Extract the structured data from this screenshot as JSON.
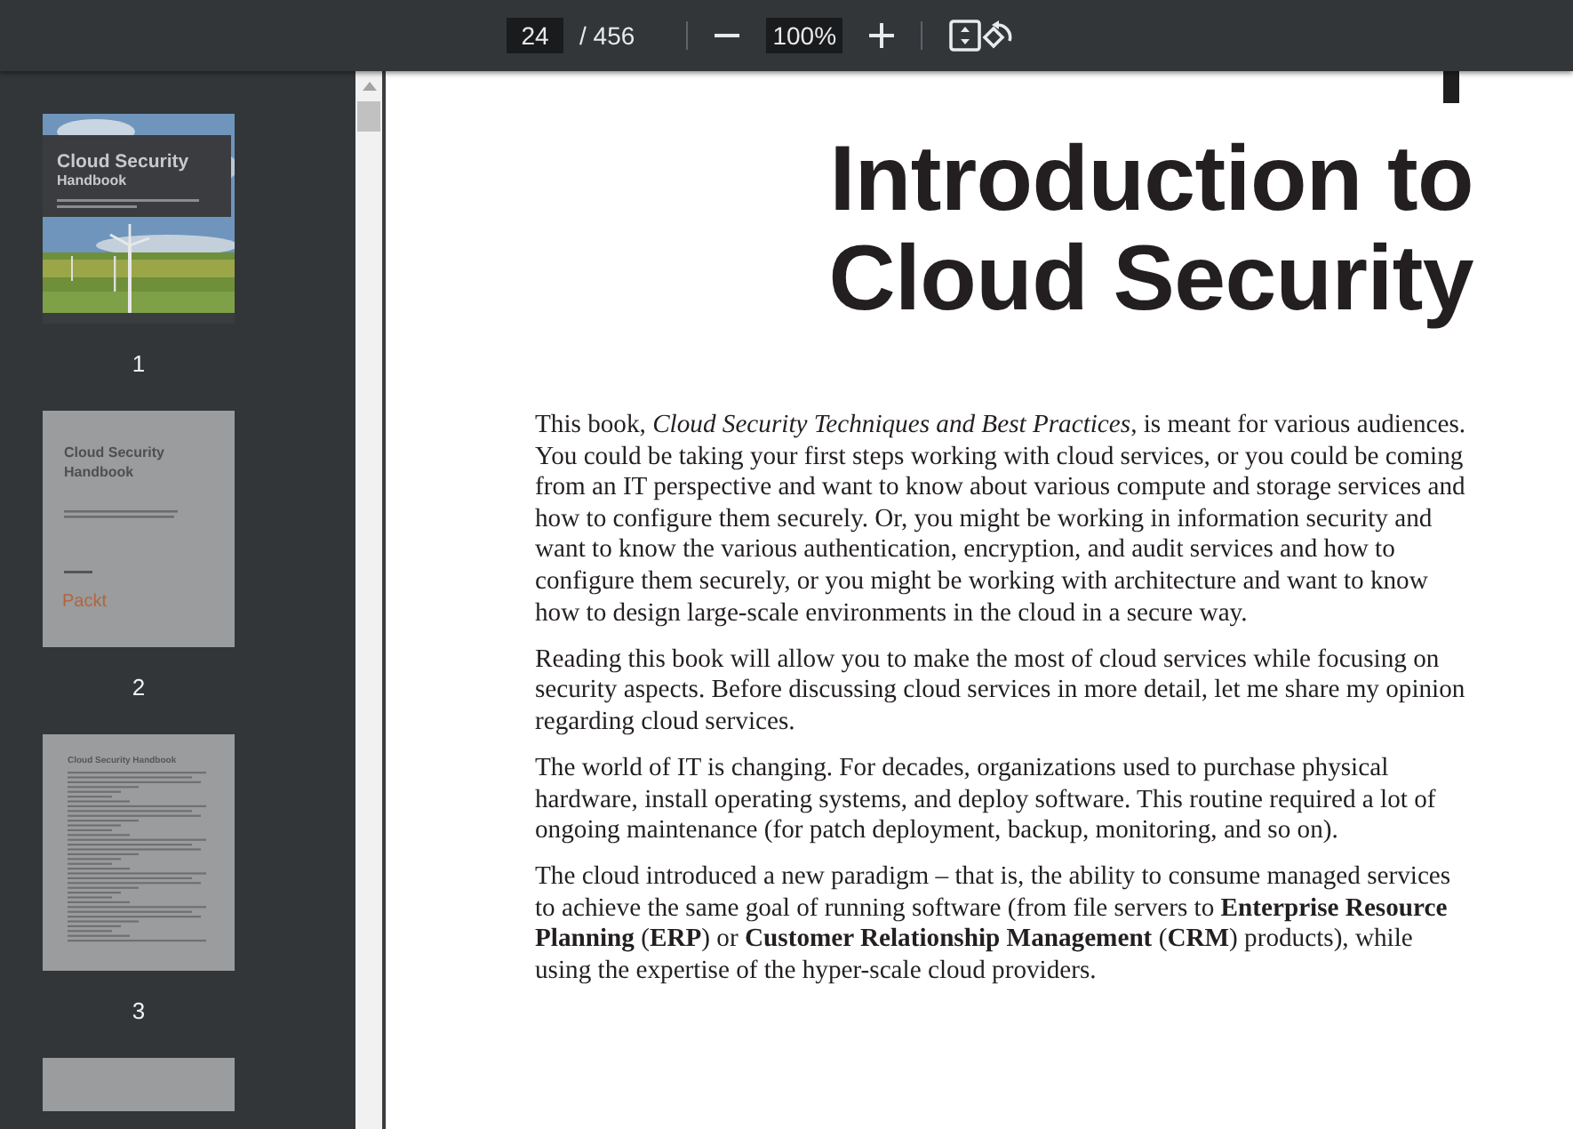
{
  "toolbar": {
    "page_input": "24",
    "page_count": "/ 456",
    "zoom": "100%"
  },
  "sidebar": {
    "thumbnails": [
      {
        "kind": "cover",
        "title_lines": [
          "Cloud Security",
          "Handbook"
        ],
        "page_label": "1"
      },
      {
        "kind": "title",
        "title_lines": [
          "Cloud Security",
          "Handbook"
        ],
        "logo": "Packt",
        "page_label": "2"
      },
      {
        "kind": "copyright",
        "title_lines": [
          "Cloud Security Handbook"
        ],
        "page_label": "3"
      },
      {
        "kind": "partial"
      }
    ]
  },
  "document": {
    "heading_lines": [
      "Introduction to",
      "Cloud Security"
    ],
    "paragraphs": [
      "This book, *Cloud Security Techniques and Best Practices*, is meant for various audiences. You could be taking your first steps working with cloud services, or you could be coming from an IT perspective and want to know about various compute and storage services and how to configure them securely. Or, you might be working in information security and want to know the various authentication, encryption, and audit services and how to configure them securely, or you might be working with architecture and want to know how to design large-scale environments in the cloud in a secure way.",
      "Reading this book will allow you to make the most of cloud services while focusing on security aspects. Before discussing cloud services in more detail, let me share my opinion regarding cloud services.",
      "The world of IT is changing. For decades, organizations used to purchase physical hardware, install operating systems, and deploy software. This routine required a lot of ongoing maintenance (for patch deployment, backup, monitoring, and so on).",
      "The cloud introduced a new paradigm – that is, the ability to consume managed services to achieve the same goal of running software (from file servers to **Enterprise Resource Planning** (**ERP**) or **Customer Relationship Management** (**CRM**) products), while using the expertise of the hyper-scale cloud providers."
    ]
  }
}
